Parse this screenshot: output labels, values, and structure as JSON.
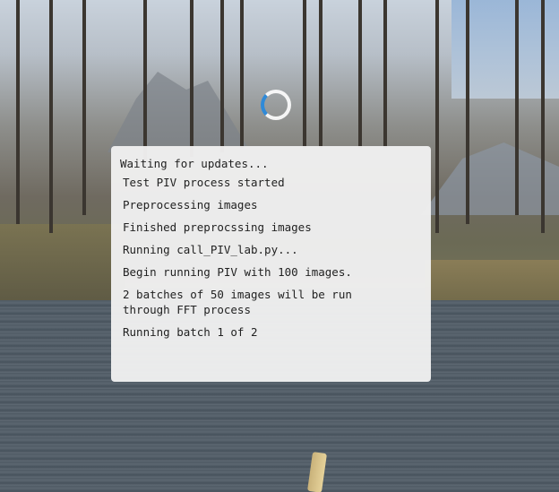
{
  "status": {
    "title": "Waiting for updates...",
    "messages": [
      "Test PIV process started",
      "Preprocessing images",
      "Finished preprocssing images",
      "Running call_PIV_lab.py...",
      "Begin running PIV with 100 images.",
      "2 batches of 50 images will be run through FFT process",
      "Running batch 1 of 2"
    ]
  },
  "spinner": {
    "icon": "loading-spinner-icon",
    "color": "#2f8ad8"
  },
  "background": {
    "icon": "river-photo-background"
  }
}
